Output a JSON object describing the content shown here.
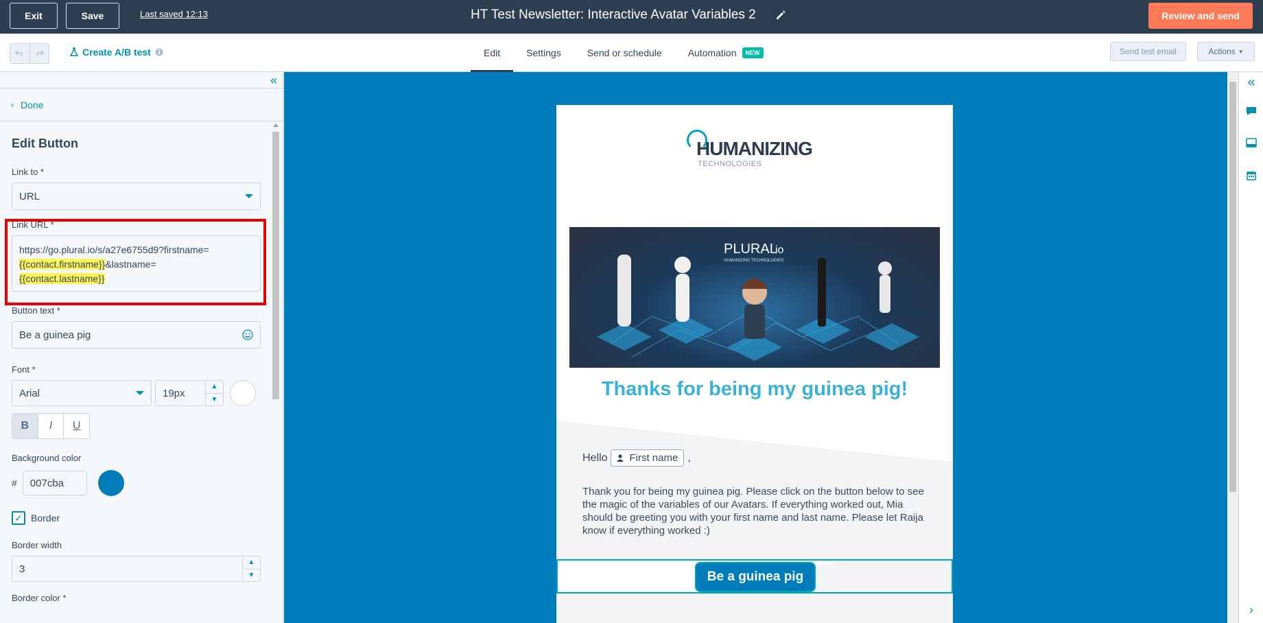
{
  "topbar": {
    "exit_label": "Exit",
    "save_label": "Save",
    "last_saved": "Last saved 12:13",
    "title": "HT Test Newsletter: Interactive Avatar Variables 2",
    "review_label": "Review and send"
  },
  "subbar": {
    "ab_test_label": "Create A/B test",
    "tabs": [
      {
        "label": "Edit"
      },
      {
        "label": "Settings"
      },
      {
        "label": "Send or schedule"
      },
      {
        "label": "Automation"
      }
    ],
    "new_badge": "NEW",
    "send_test_label": "Send test email",
    "actions_label": "Actions"
  },
  "panel": {
    "done_label": "Done",
    "heading": "Edit Button",
    "link_to_label": "Link to *",
    "link_to_value": "URL",
    "link_url_label": "Link URL *",
    "link_url_prefix": "https://go.plural.io/s/a27e6755d9?firstname=",
    "link_url_token1": "{{contact.firstname}}",
    "link_url_mid": "&lastname=",
    "link_url_token2": "{{contact.lastname}}",
    "button_text_label": "Button text *",
    "button_text_value": "Be a guinea pig",
    "font_label": "Font *",
    "font_value": "Arial",
    "font_size": "19px",
    "style_bold": "B",
    "style_italic": "I",
    "style_underline": "U",
    "bg_color_label": "Background color",
    "hash": "#",
    "bg_color_value": "007cba",
    "border_label": "Border",
    "border_checked": true,
    "border_width_label": "Border width",
    "border_width_value": "3",
    "border_color_label": "Border color *"
  },
  "email": {
    "logo_text": "HUMANIZING",
    "logo_sub": "TECHNOLOGIES",
    "hero_brand": "PLURAL",
    "hero_brand_suffix": "io",
    "hero_sub": "HUMANIZING TECHNOLOGIES",
    "headline": "Thanks for being my guinea pig!",
    "hello": "Hello",
    "first_name_token": "First name",
    "comma": ",",
    "body": "Thank you for being my guinea pig. Please click on the button below to see the magic of the variables of our Avatars. If everything worked out, Mia should be greeting you with your first name and last name. Please let Raija know if everything worked :)",
    "button_label": "Be a guinea pig"
  },
  "colors": {
    "topbar": "#2d3e50",
    "accent_orange": "#ff7a59",
    "link_teal": "#0091ae",
    "canvas_blue": "#007cba",
    "headline_blue": "#3ab2d8",
    "highlight": "#fdf45a",
    "annotation_red": "#e00000"
  }
}
